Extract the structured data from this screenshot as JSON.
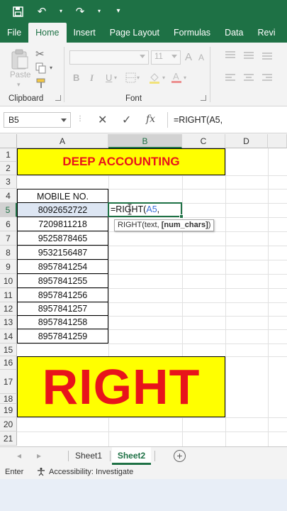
{
  "quick_access": {
    "save_icon": "save-icon",
    "undo_icon": "undo-icon",
    "redo_icon": "redo-icon",
    "customize_icon": "customize-quick-access-icon"
  },
  "tabs": [
    {
      "label": "File",
      "active": false
    },
    {
      "label": "Home",
      "active": true
    },
    {
      "label": "Insert",
      "active": false
    },
    {
      "label": "Page Layout",
      "active": false
    },
    {
      "label": "Formulas",
      "active": false
    },
    {
      "label": "Data",
      "active": false
    },
    {
      "label": "Revi",
      "active": false
    }
  ],
  "ribbon": {
    "clipboard_label": "Clipboard",
    "paste_label": "Paste",
    "font_label": "Font",
    "font_size": "11",
    "bold": "B",
    "italic": "I",
    "underline": "U",
    "grow_font": "A",
    "shrink_font": "A"
  },
  "formula_bar": {
    "name_box": "B5",
    "cancel": "✕",
    "enter": "✓",
    "fx": "fx",
    "formula": "=RIGHT(A5,"
  },
  "columns": [
    "A",
    "B",
    "C",
    "D"
  ],
  "rows": [
    "1",
    "2",
    "3",
    "4",
    "5",
    "6",
    "7",
    "8",
    "9",
    "10",
    "11",
    "12",
    "13",
    "14",
    "15",
    "16",
    "17",
    "18",
    "19",
    "20",
    "21"
  ],
  "banner_top": "DEEP ACCOUNTING",
  "table": {
    "header": "MOBILE NO.",
    "values": [
      "8092652722",
      "7209811218",
      "9525878465",
      "9532156487",
      "8957841254",
      "8957841255",
      "8957841256",
      "8957841257",
      "8957841258",
      "8957841259"
    ]
  },
  "active_cell": {
    "fn": "=RIGHT(",
    "ref": "A5",
    "tail": ","
  },
  "tooltip": {
    "fn": "RIGHT(text, ",
    "arg": "[num_chars]",
    "close": ")"
  },
  "banner_bottom": "RIGHT",
  "sheets": [
    {
      "label": "Sheet1",
      "active": false
    },
    {
      "label": "Sheet2",
      "active": true
    }
  ],
  "add_sheet": "+",
  "status": {
    "mode": "Enter",
    "accessibility": "Accessibility: Investigate"
  },
  "colors": {
    "excel_green": "#1e7145",
    "banner_yellow": "#ffff00",
    "banner_red": "#e8141b",
    "ref_blue": "#3a6fd8"
  }
}
